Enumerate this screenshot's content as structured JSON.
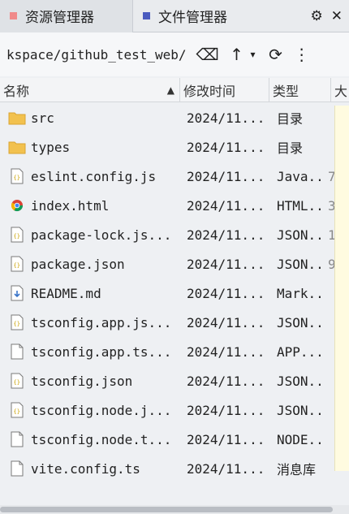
{
  "tabs": [
    {
      "label": "资源管理器",
      "color": "#f08a8a"
    },
    {
      "label": "文件管理器",
      "color": "#4a5bbf"
    }
  ],
  "path": "kspace/github_test_web/",
  "columns": {
    "name": "名称",
    "modified": "修改时间",
    "type": "类型",
    "size": "大"
  },
  "files": [
    {
      "name": "src",
      "date": "2024/11...",
      "type": "目录",
      "size": "",
      "icon": "folder-icon"
    },
    {
      "name": "types",
      "date": "2024/11...",
      "type": "目录",
      "size": "",
      "icon": "folder-icon"
    },
    {
      "name": "eslint.config.js",
      "date": "2024/11...",
      "type": "Java...",
      "size": "7",
      "icon": "js-file-icon"
    },
    {
      "name": "index.html",
      "date": "2024/11...",
      "type": "HTML...",
      "size": "3",
      "icon": "chrome-html-icon"
    },
    {
      "name": "package-lock.js...",
      "date": "2024/11...",
      "type": "JSON...",
      "size": "1",
      "icon": "json-file-icon"
    },
    {
      "name": "package.json",
      "date": "2024/11...",
      "type": "JSON...",
      "size": "9",
      "icon": "json-file-icon"
    },
    {
      "name": "README.md",
      "date": "2024/11...",
      "type": "Mark...",
      "size": "",
      "icon": "markdown-file-icon"
    },
    {
      "name": "tsconfig.app.js...",
      "date": "2024/11...",
      "type": "JSON...",
      "size": "",
      "icon": "json-file-icon"
    },
    {
      "name": "tsconfig.app.ts...",
      "date": "2024/11...",
      "type": "APP...",
      "size": "",
      "icon": "blank-file-icon"
    },
    {
      "name": "tsconfig.json",
      "date": "2024/11...",
      "type": "JSON...",
      "size": "",
      "icon": "json-file-icon"
    },
    {
      "name": "tsconfig.node.j...",
      "date": "2024/11...",
      "type": "JSON...",
      "size": "",
      "icon": "json-file-icon"
    },
    {
      "name": "tsconfig.node.t...",
      "date": "2024/11...",
      "type": "NODE...",
      "size": "",
      "icon": "blank-file-icon"
    },
    {
      "name": "vite.config.ts",
      "date": "2024/11...",
      "type": "消息库",
      "size": "",
      "icon": "blank-file-icon"
    }
  ]
}
